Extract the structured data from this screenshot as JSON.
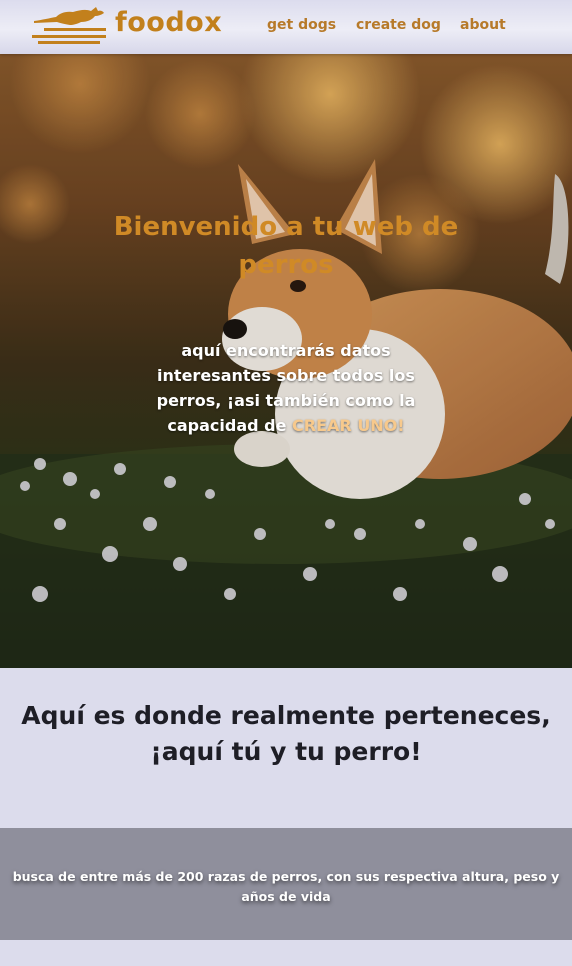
{
  "navbar": {
    "brand": "foodox",
    "logo_icon": "running-dog-icon",
    "links": [
      "get dogs",
      "create dog",
      "about"
    ]
  },
  "hero": {
    "image": "corgi-puppy-in-grass-photo",
    "title": "Bienvenido a tu web de perros",
    "text": "aquí encontrarás datos interesantes sobre todos los perros, ¡asi también como la capacidad de ",
    "cta": "CREAR UNO!"
  },
  "belong": {
    "title": "Aquí es donde realmente perteneces, ¡aquí tú y tu perro!"
  },
  "search": {
    "text": "busca de entre más de 200 razas de perros, con sus respectiva altura, peso y años de vida"
  },
  "colors": {
    "accent": "#c2801c",
    "nav_bg": "#e6e6f2",
    "section_bg": "#dcdcec",
    "band_bg": "#8f8f9c",
    "cta": "#f7c98c"
  }
}
